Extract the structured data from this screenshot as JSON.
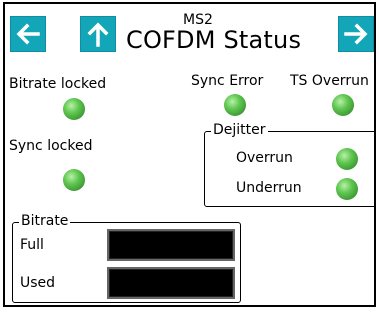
{
  "header": {
    "subtitle": "MS2",
    "title": "COFDM Status",
    "back_icon": "arrow-left-icon",
    "up_icon": "arrow-up-icon",
    "next_icon": "arrow-right-icon",
    "button_color": "#12a6b8"
  },
  "indicators": {
    "bitrate_locked": "Bitrate locked",
    "sync_error": "Sync Error",
    "ts_overrun": "TS Overrun",
    "sync_locked": "Sync locked",
    "led_color": "#4caf3f"
  },
  "dejitter": {
    "title": "Dejitter",
    "overrun": "Overrun",
    "underrun": "Underrun"
  },
  "bitrate": {
    "title": "Bitrate",
    "full_label": "Full",
    "used_label": "Used",
    "full_value": "",
    "used_value": ""
  }
}
